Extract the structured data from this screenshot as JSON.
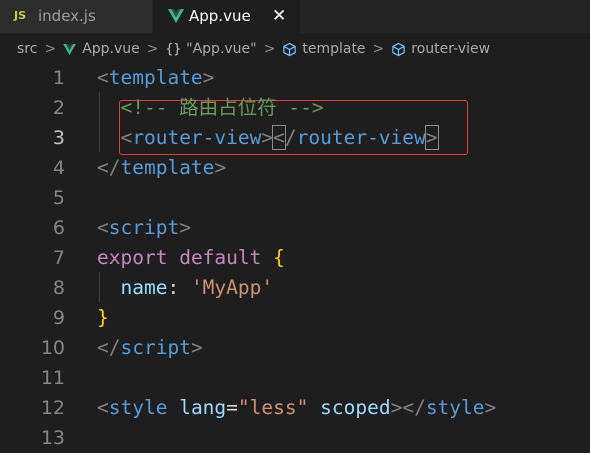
{
  "tabs": [
    {
      "badge": "JS",
      "label": "index.js",
      "active": false
    },
    {
      "label": "App.vue",
      "active": true,
      "close": "✕"
    }
  ],
  "breadcrumb": {
    "items": [
      "src",
      "App.vue",
      "\"App.vue\"",
      "template",
      "router-view"
    ],
    "separator": ">",
    "braces": "{}"
  },
  "colors": {
    "background": "#1e1e1e",
    "tag": "#569cd6",
    "comment": "#6a9955",
    "keyword": "#c586c0",
    "string": "#ce9178",
    "property": "#9cdcfe",
    "brace": "#ffd700",
    "highlight": "#e03c3c"
  },
  "editor": {
    "active_line": 3,
    "lines": [
      {
        "num": "1",
        "tokens": [
          {
            "t": "<",
            "c": "punct"
          },
          {
            "t": "template",
            "c": "tag"
          },
          {
            "t": ">",
            "c": "punct"
          }
        ]
      },
      {
        "num": "2",
        "tokens": [
          {
            "t": "  ",
            "c": "plain"
          },
          {
            "t": "<!-- 路由占位符 -->",
            "c": "comment"
          }
        ]
      },
      {
        "num": "3",
        "tokens": [
          {
            "t": "  ",
            "c": "plain"
          },
          {
            "t": "<",
            "c": "punct"
          },
          {
            "t": "router-view",
            "c": "tag"
          },
          {
            "t": ">",
            "c": "punct"
          },
          {
            "t": "<",
            "c": "punct",
            "m": true
          },
          {
            "t": "/",
            "c": "punct"
          },
          {
            "t": "router-view",
            "c": "tag"
          },
          {
            "t": ">",
            "c": "punct",
            "m": true
          }
        ]
      },
      {
        "num": "4",
        "tokens": [
          {
            "t": "</",
            "c": "punct"
          },
          {
            "t": "template",
            "c": "tag"
          },
          {
            "t": ">",
            "c": "punct"
          }
        ]
      },
      {
        "num": "5",
        "tokens": []
      },
      {
        "num": "6",
        "tokens": [
          {
            "t": "<",
            "c": "punct"
          },
          {
            "t": "script",
            "c": "tag"
          },
          {
            "t": ">",
            "c": "punct"
          }
        ]
      },
      {
        "num": "7",
        "tokens": [
          {
            "t": "export",
            "c": "kw"
          },
          {
            "t": " ",
            "c": "plain"
          },
          {
            "t": "default",
            "c": "kw"
          },
          {
            "t": " ",
            "c": "plain"
          },
          {
            "t": "{",
            "c": "brace"
          }
        ]
      },
      {
        "num": "8",
        "tokens": [
          {
            "t": "  ",
            "c": "plain"
          },
          {
            "t": "name",
            "c": "prop"
          },
          {
            "t": ": ",
            "c": "plain"
          },
          {
            "t": "'MyApp'",
            "c": "str"
          }
        ]
      },
      {
        "num": "9",
        "tokens": [
          {
            "t": "}",
            "c": "brace"
          }
        ]
      },
      {
        "num": "10",
        "tokens": [
          {
            "t": "</",
            "c": "punct"
          },
          {
            "t": "script",
            "c": "tag"
          },
          {
            "t": ">",
            "c": "punct"
          }
        ]
      },
      {
        "num": "11",
        "tokens": []
      },
      {
        "num": "12",
        "tokens": [
          {
            "t": "<",
            "c": "punct"
          },
          {
            "t": "style",
            "c": "tag"
          },
          {
            "t": " ",
            "c": "plain"
          },
          {
            "t": "lang",
            "c": "prop"
          },
          {
            "t": "=",
            "c": "plain"
          },
          {
            "t": "\"less\"",
            "c": "str"
          },
          {
            "t": " ",
            "c": "plain"
          },
          {
            "t": "scoped",
            "c": "prop"
          },
          {
            "t": "><",
            "c": "punct"
          },
          {
            "t": "/",
            "c": "punct"
          },
          {
            "t": "style",
            "c": "tag"
          },
          {
            "t": ">",
            "c": "punct"
          }
        ]
      },
      {
        "num": "13",
        "tokens": []
      }
    ]
  }
}
